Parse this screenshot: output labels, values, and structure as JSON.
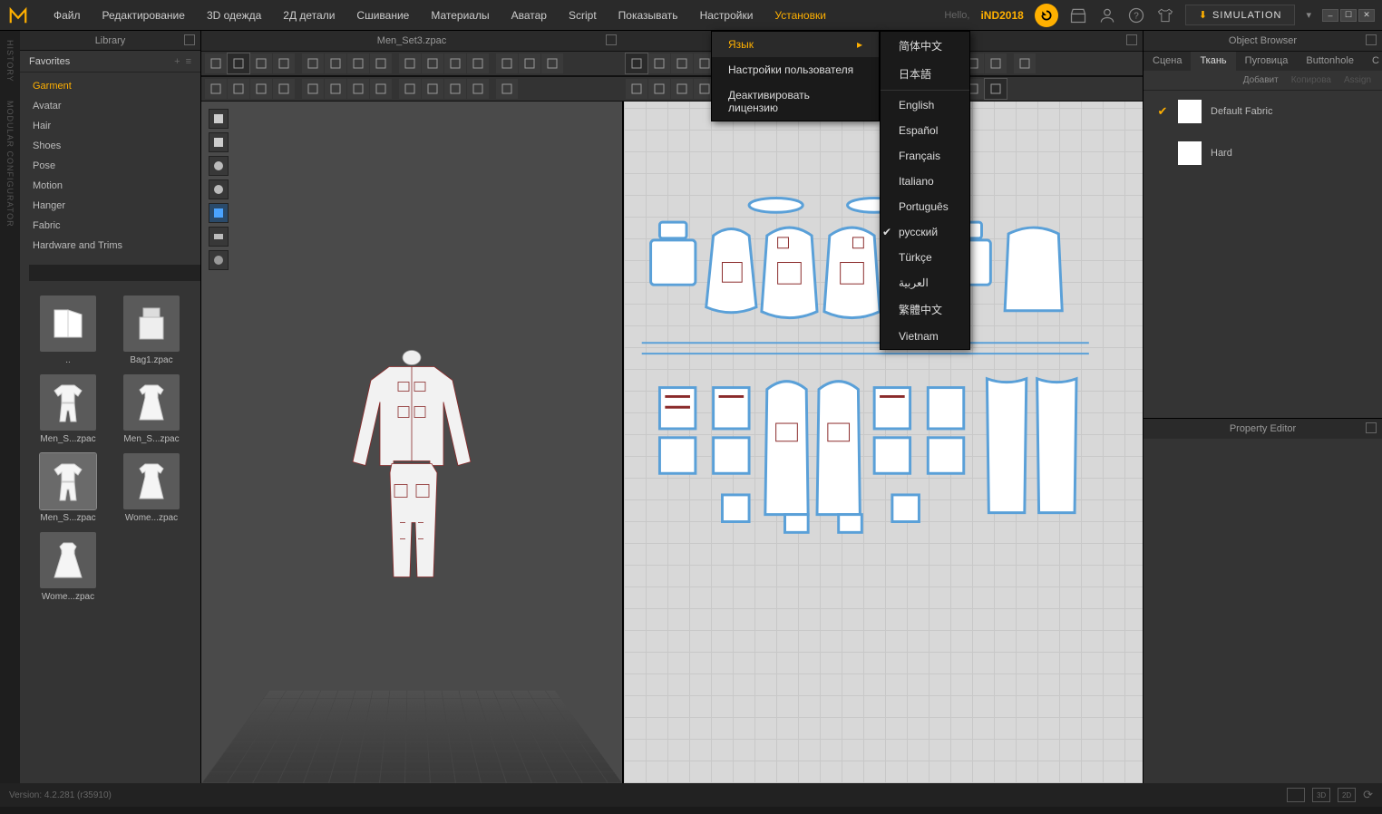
{
  "menubar": {
    "items": [
      "Файл",
      "Редактирование",
      "3D одежда",
      "2Д детали",
      "Сшивание",
      "Материалы",
      "Аватар",
      "Script",
      "Показывать",
      "Настройки",
      "Установки"
    ],
    "active_index": 10,
    "greeting": "Hello,",
    "user": "iND2018",
    "simulation_label": "SIMULATION"
  },
  "settings_menu": {
    "items": [
      {
        "label": "Язык",
        "submenu": true,
        "selected": true
      },
      {
        "label": "Настройки пользователя"
      },
      {
        "label": "Деактивировать лицензию"
      }
    ]
  },
  "language_menu": {
    "items": [
      {
        "label": "简体中文"
      },
      {
        "label": "日本語"
      },
      {
        "sep": true
      },
      {
        "label": "English"
      },
      {
        "label": "Español"
      },
      {
        "label": "Français"
      },
      {
        "label": "Italiano"
      },
      {
        "label": "Português"
      },
      {
        "label": "русский",
        "checked": true
      },
      {
        "label": "Türkçe"
      },
      {
        "label": "العربية"
      },
      {
        "label": "繁體中文"
      },
      {
        "label": "Vietnam"
      }
    ]
  },
  "left_tabs": [
    "HISTORY",
    "MODULAR CONFIGURATOR"
  ],
  "library": {
    "title": "Library",
    "favorites_label": "Favorites",
    "categories": [
      "Garment",
      "Avatar",
      "Hair",
      "Shoes",
      "Pose",
      "Motion",
      "Hanger",
      "Fabric",
      "Hardware and Trims"
    ],
    "selected_category": 0,
    "thumbs": [
      {
        "label": "..",
        "kind": "folder"
      },
      {
        "label": "Bag1.zpac",
        "kind": "bag"
      },
      {
        "label": "Men_S...zpac",
        "kind": "suit"
      },
      {
        "label": "Men_S...zpac",
        "kind": "dress"
      },
      {
        "label": "Men_S...zpac",
        "kind": "suit",
        "selected": true
      },
      {
        "label": "Wome...zpac",
        "kind": "dress"
      },
      {
        "label": "Wome...zpac",
        "kind": "dress2"
      }
    ]
  },
  "document": {
    "title": "Men_Set3.zpac"
  },
  "object_browser": {
    "title": "Object Browser",
    "tabs": [
      "Сцена",
      "Ткань",
      "Пуговица",
      "Buttonhole",
      "С"
    ],
    "selected_tab": 1,
    "actions": {
      "add": "Добавит",
      "copy": "Копирова",
      "assign": "Assign"
    },
    "fabrics": [
      {
        "name": "Default Fabric",
        "checked": true
      },
      {
        "name": "Hard",
        "checked": false
      }
    ]
  },
  "property_editor": {
    "title": "Property Editor"
  },
  "statusbar": {
    "version": "Version: 4.2.281 (r35910)",
    "boxes": [
      "",
      "3D",
      "2D"
    ]
  }
}
